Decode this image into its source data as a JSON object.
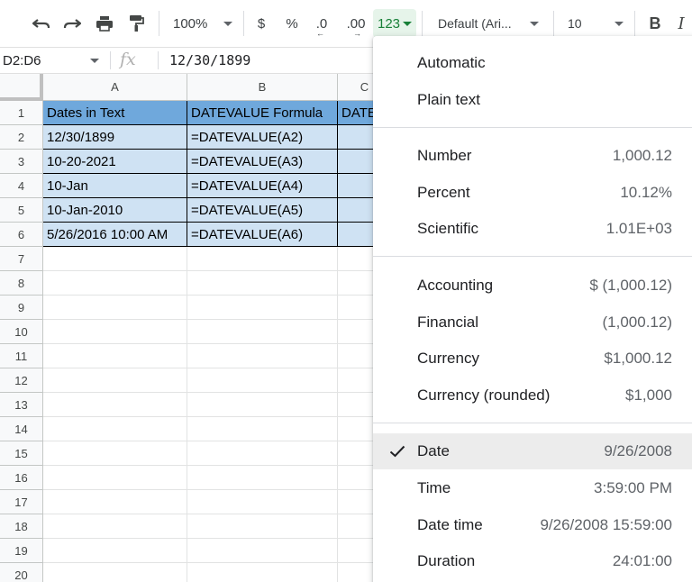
{
  "toolbar": {
    "zoom": "100%",
    "currency": "$",
    "percent": "%",
    "dec_decrease": ".0",
    "dec_increase": ".00",
    "more_formats": "123",
    "font": "Default (Ari...",
    "font_size": "10",
    "bold": "B",
    "italic": "I"
  },
  "formula_bar": {
    "range": "D2:D6",
    "fx": "fx",
    "value": "12/30/1899"
  },
  "columns": [
    "A",
    "B",
    "C"
  ],
  "rows": [
    "1",
    "2",
    "3",
    "4",
    "5",
    "6",
    "7",
    "8",
    "9",
    "10",
    "11",
    "12",
    "13",
    "14",
    "15",
    "16",
    "17",
    "18",
    "19",
    "20"
  ],
  "cells": {
    "A1": "Dates in Text",
    "B1": "DATEVALUE Formula",
    "C1": "DATE",
    "A2": "12/30/1899",
    "B2": "=DATEVALUE(A2)",
    "A3": "10-20-2021",
    "B3": "=DATEVALUE(A3)",
    "A4": "10-Jan",
    "B4": "=DATEVALUE(A4)",
    "A5": "10-Jan-2010",
    "B5": "=DATEVALUE(A5)",
    "A6": "5/26/2016 10:00 AM",
    "B6": "=DATEVALUE(A6)"
  },
  "menu": {
    "automatic": "Automatic",
    "plain_text": "Plain text",
    "number": {
      "label": "Number",
      "example": "1,000.12"
    },
    "percent": {
      "label": "Percent",
      "example": "10.12%"
    },
    "scientific": {
      "label": "Scientific",
      "example": "1.01E+03"
    },
    "accounting": {
      "label": "Accounting",
      "example": "$ (1,000.12)"
    },
    "financial": {
      "label": "Financial",
      "example": "(1,000.12)"
    },
    "currency": {
      "label": "Currency",
      "example": "$1,000.12"
    },
    "currency_rounded": {
      "label": "Currency (rounded)",
      "example": "$1,000"
    },
    "date": {
      "label": "Date",
      "example": "9/26/2008"
    },
    "time": {
      "label": "Time",
      "example": "3:59:00 PM"
    },
    "date_time": {
      "label": "Date time",
      "example": "9/26/2008 15:59:00"
    },
    "duration": {
      "label": "Duration",
      "example": "24:01:00"
    }
  },
  "colors": {
    "header_fill": "#6fa8dc",
    "data_fill": "#cfe2f3",
    "active_format": "#188038"
  }
}
